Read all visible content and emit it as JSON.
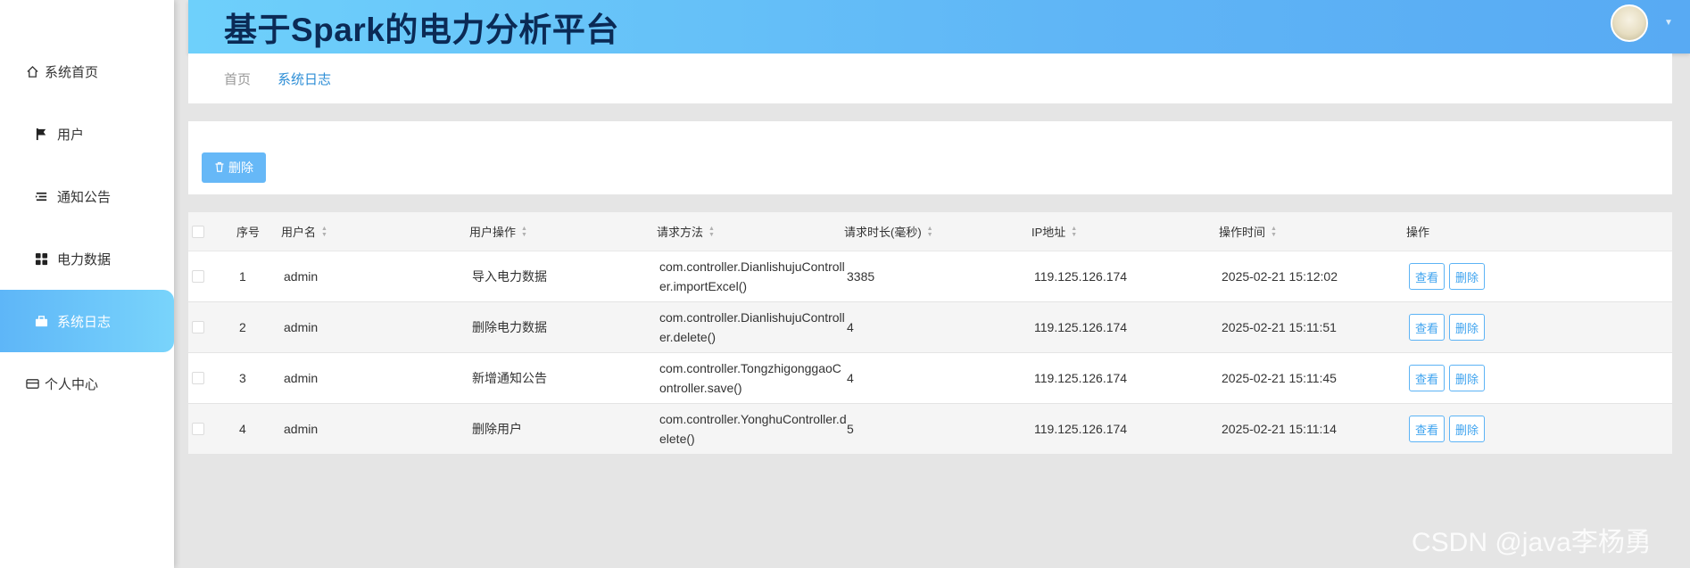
{
  "app": {
    "title": "基于Spark的电力分析平台"
  },
  "sidebar": {
    "items": [
      {
        "label": "系统首页",
        "icon": "home-icon"
      },
      {
        "label": "用户",
        "icon": "flag-icon"
      },
      {
        "label": "通知公告",
        "icon": "list-icon"
      },
      {
        "label": "电力数据",
        "icon": "grid-icon"
      },
      {
        "label": "系统日志",
        "icon": "briefcase-icon",
        "active": true
      },
      {
        "label": "个人中心",
        "icon": "card-icon"
      }
    ]
  },
  "breadcrumb": {
    "home": "首页",
    "current": "系统日志"
  },
  "toolbar": {
    "delete_label": "删除"
  },
  "table": {
    "headers": [
      "序号",
      "用户名",
      "用户操作",
      "请求方法",
      "请求时长(毫秒)",
      "IP地址",
      "操作时间",
      "操作"
    ],
    "rows": [
      {
        "index": "1",
        "username": "admin",
        "operation": "导入电力数据",
        "method": "com.controller.DianlishujuController.importExcel()",
        "duration": "3385",
        "ip": "119.125.126.174",
        "time": "2025-02-21 15:12:02"
      },
      {
        "index": "2",
        "username": "admin",
        "operation": "删除电力数据",
        "method": "com.controller.DianlishujuController.delete()",
        "duration": "4",
        "ip": "119.125.126.174",
        "time": "2025-02-21 15:11:51"
      },
      {
        "index": "3",
        "username": "admin",
        "operation": "新增通知公告",
        "method": "com.controller.TongzhigonggaoController.save()",
        "duration": "4",
        "ip": "119.125.126.174",
        "time": "2025-02-21 15:11:45"
      },
      {
        "index": "4",
        "username": "admin",
        "operation": "删除用户",
        "method": "com.controller.YonghuController.delete()",
        "duration": "5",
        "ip": "119.125.126.174",
        "time": "2025-02-21 15:11:14"
      }
    ],
    "actions": {
      "view": "查看",
      "delete": "删除"
    }
  },
  "watermark": "CSDN @java李杨勇",
  "colors": {
    "accent": "#5eb6f8",
    "title": "#0b2a55",
    "link": "#2d8ed6"
  }
}
